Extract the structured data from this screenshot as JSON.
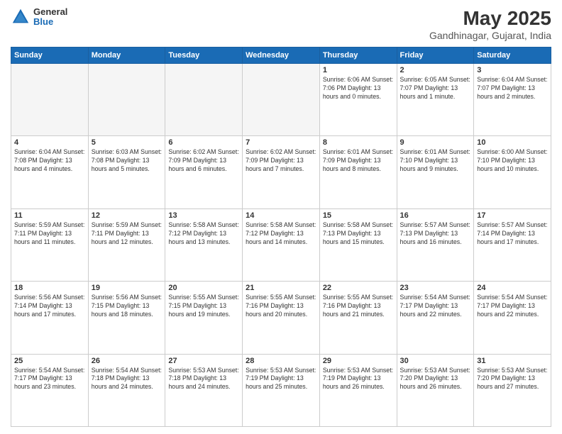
{
  "logo": {
    "general": "General",
    "blue": "Blue"
  },
  "header": {
    "month_year": "May 2025",
    "location": "Gandhinagar, Gujarat, India"
  },
  "weekdays": [
    "Sunday",
    "Monday",
    "Tuesday",
    "Wednesday",
    "Thursday",
    "Friday",
    "Saturday"
  ],
  "weeks": [
    [
      {
        "day": "",
        "empty": true
      },
      {
        "day": "",
        "empty": true
      },
      {
        "day": "",
        "empty": true
      },
      {
        "day": "",
        "empty": true
      },
      {
        "day": "1",
        "info": "Sunrise: 6:06 AM\nSunset: 7:06 PM\nDaylight: 13 hours\nand 0 minutes."
      },
      {
        "day": "2",
        "info": "Sunrise: 6:05 AM\nSunset: 7:07 PM\nDaylight: 13 hours\nand 1 minute."
      },
      {
        "day": "3",
        "info": "Sunrise: 6:04 AM\nSunset: 7:07 PM\nDaylight: 13 hours\nand 2 minutes."
      }
    ],
    [
      {
        "day": "4",
        "info": "Sunrise: 6:04 AM\nSunset: 7:08 PM\nDaylight: 13 hours\nand 4 minutes."
      },
      {
        "day": "5",
        "info": "Sunrise: 6:03 AM\nSunset: 7:08 PM\nDaylight: 13 hours\nand 5 minutes."
      },
      {
        "day": "6",
        "info": "Sunrise: 6:02 AM\nSunset: 7:09 PM\nDaylight: 13 hours\nand 6 minutes."
      },
      {
        "day": "7",
        "info": "Sunrise: 6:02 AM\nSunset: 7:09 PM\nDaylight: 13 hours\nand 7 minutes."
      },
      {
        "day": "8",
        "info": "Sunrise: 6:01 AM\nSunset: 7:09 PM\nDaylight: 13 hours\nand 8 minutes."
      },
      {
        "day": "9",
        "info": "Sunrise: 6:01 AM\nSunset: 7:10 PM\nDaylight: 13 hours\nand 9 minutes."
      },
      {
        "day": "10",
        "info": "Sunrise: 6:00 AM\nSunset: 7:10 PM\nDaylight: 13 hours\nand 10 minutes."
      }
    ],
    [
      {
        "day": "11",
        "info": "Sunrise: 5:59 AM\nSunset: 7:11 PM\nDaylight: 13 hours\nand 11 minutes."
      },
      {
        "day": "12",
        "info": "Sunrise: 5:59 AM\nSunset: 7:11 PM\nDaylight: 13 hours\nand 12 minutes."
      },
      {
        "day": "13",
        "info": "Sunrise: 5:58 AM\nSunset: 7:12 PM\nDaylight: 13 hours\nand 13 minutes."
      },
      {
        "day": "14",
        "info": "Sunrise: 5:58 AM\nSunset: 7:12 PM\nDaylight: 13 hours\nand 14 minutes."
      },
      {
        "day": "15",
        "info": "Sunrise: 5:58 AM\nSunset: 7:13 PM\nDaylight: 13 hours\nand 15 minutes."
      },
      {
        "day": "16",
        "info": "Sunrise: 5:57 AM\nSunset: 7:13 PM\nDaylight: 13 hours\nand 16 minutes."
      },
      {
        "day": "17",
        "info": "Sunrise: 5:57 AM\nSunset: 7:14 PM\nDaylight: 13 hours\nand 17 minutes."
      }
    ],
    [
      {
        "day": "18",
        "info": "Sunrise: 5:56 AM\nSunset: 7:14 PM\nDaylight: 13 hours\nand 17 minutes."
      },
      {
        "day": "19",
        "info": "Sunrise: 5:56 AM\nSunset: 7:15 PM\nDaylight: 13 hours\nand 18 minutes."
      },
      {
        "day": "20",
        "info": "Sunrise: 5:55 AM\nSunset: 7:15 PM\nDaylight: 13 hours\nand 19 minutes."
      },
      {
        "day": "21",
        "info": "Sunrise: 5:55 AM\nSunset: 7:16 PM\nDaylight: 13 hours\nand 20 minutes."
      },
      {
        "day": "22",
        "info": "Sunrise: 5:55 AM\nSunset: 7:16 PM\nDaylight: 13 hours\nand 21 minutes."
      },
      {
        "day": "23",
        "info": "Sunrise: 5:54 AM\nSunset: 7:17 PM\nDaylight: 13 hours\nand 22 minutes."
      },
      {
        "day": "24",
        "info": "Sunrise: 5:54 AM\nSunset: 7:17 PM\nDaylight: 13 hours\nand 22 minutes."
      }
    ],
    [
      {
        "day": "25",
        "info": "Sunrise: 5:54 AM\nSunset: 7:17 PM\nDaylight: 13 hours\nand 23 minutes."
      },
      {
        "day": "26",
        "info": "Sunrise: 5:54 AM\nSunset: 7:18 PM\nDaylight: 13 hours\nand 24 minutes."
      },
      {
        "day": "27",
        "info": "Sunrise: 5:53 AM\nSunset: 7:18 PM\nDaylight: 13 hours\nand 24 minutes."
      },
      {
        "day": "28",
        "info": "Sunrise: 5:53 AM\nSunset: 7:19 PM\nDaylight: 13 hours\nand 25 minutes."
      },
      {
        "day": "29",
        "info": "Sunrise: 5:53 AM\nSunset: 7:19 PM\nDaylight: 13 hours\nand 26 minutes."
      },
      {
        "day": "30",
        "info": "Sunrise: 5:53 AM\nSunset: 7:20 PM\nDaylight: 13 hours\nand 26 minutes."
      },
      {
        "day": "31",
        "info": "Sunrise: 5:53 AM\nSunset: 7:20 PM\nDaylight: 13 hours\nand 27 minutes."
      }
    ]
  ]
}
